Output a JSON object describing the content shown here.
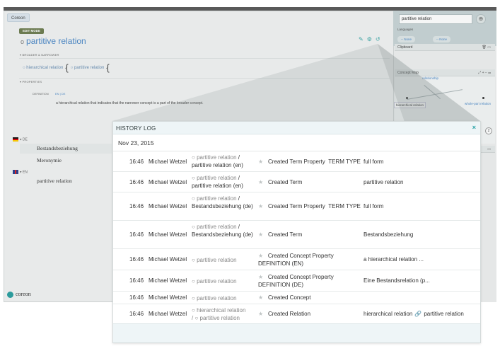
{
  "app": {
    "breadcrumb": "Coreon",
    "edit_mode_badge": "EDIT MODE",
    "concept_title": "partitive relation",
    "logo": "coreon"
  },
  "concept": {
    "broader_narrower_heading": "BROADER & NARROWER",
    "broader_label": "hierarchical relation",
    "self_label": "partitive relation",
    "properties_heading": "PROPERTIES",
    "definition_label": "DEFINITION",
    "definition_langs": "EN | DE",
    "definition_text": "a hierarchical relation that indicates that the narrower concept is a part of the broader concept."
  },
  "terms": {
    "de_label": "DE",
    "de_terms": [
      "Bestandsbeziehung",
      "Meronymie"
    ],
    "en_label": "EN",
    "en_terms": [
      "partitive relation"
    ]
  },
  "right_panel": {
    "search_value": "partitive relation",
    "languages_label": "Languages",
    "lang_none_1": "-- None",
    "lang_none_2": "-- None",
    "clipboard_label": "Clipboard",
    "concept_map_label": "Concept Map",
    "map_node_relationship": "relationship",
    "map_node_hierarchical": "hierarchical relation",
    "map_node_whole_part": "whole-part relation",
    "badge_count": "2"
  },
  "history_log": {
    "title": "HISTORY LOG",
    "date": "Nov 23, 2015",
    "rows": [
      {
        "time": "16:46",
        "user": "Michael Wetzel",
        "concept": "partitive relation",
        "concept_term": "partitive relation (en)",
        "action": "Created Term Property",
        "prop_type": "TERM TYPE",
        "detail": "full form"
      },
      {
        "time": "16:46",
        "user": "Michael Wetzel",
        "concept": "partitive relation",
        "concept_term": "partitive relation (en)",
        "action": "Created Term",
        "prop_type": "",
        "detail": "partitive relation"
      },
      {
        "time": "16:46",
        "user": "Michael Wetzel",
        "concept": "partitive relation",
        "concept_term": "Bestandsbeziehung (de)",
        "action": "Created Term Property",
        "prop_type": "TERM TYPE",
        "detail": "full form"
      },
      {
        "time": "16:46",
        "user": "Michael Wetzel",
        "concept": "partitive relation",
        "concept_term": "Bestandsbeziehung (de)",
        "action": "Created Term",
        "prop_type": "",
        "detail": "Bestandsbeziehung"
      },
      {
        "time": "16:46",
        "user": "Michael Wetzel",
        "concept": "partitive relation",
        "concept_term": "",
        "action": "Created Concept Property DEFINITION (EN)",
        "prop_type": "",
        "detail": "a hierarchical relation ..."
      },
      {
        "time": "16:46",
        "user": "Michael Wetzel",
        "concept": "partitive relation",
        "concept_term": "",
        "action": "Created Concept Property DEFINITION (DE)",
        "prop_type": "",
        "detail": "Eine Bestandsrelation (p..."
      },
      {
        "time": "16:46",
        "user": "Michael Wetzel",
        "concept": "partitive relation",
        "concept_term": "",
        "action": "Created Concept",
        "prop_type": "",
        "detail": ""
      },
      {
        "time": "16:46",
        "user": "Michael Wetzel",
        "concept": "hierarchical relation",
        "concept_term": "partitive relation",
        "action": "Created Relation",
        "prop_type": "",
        "detail": "hierarchical relation",
        "detail_target": "partitive relation"
      }
    ]
  },
  "colors": {
    "accent": "#2aa3a8",
    "link": "#4a87c7",
    "modal_header": "#eef5f7"
  }
}
